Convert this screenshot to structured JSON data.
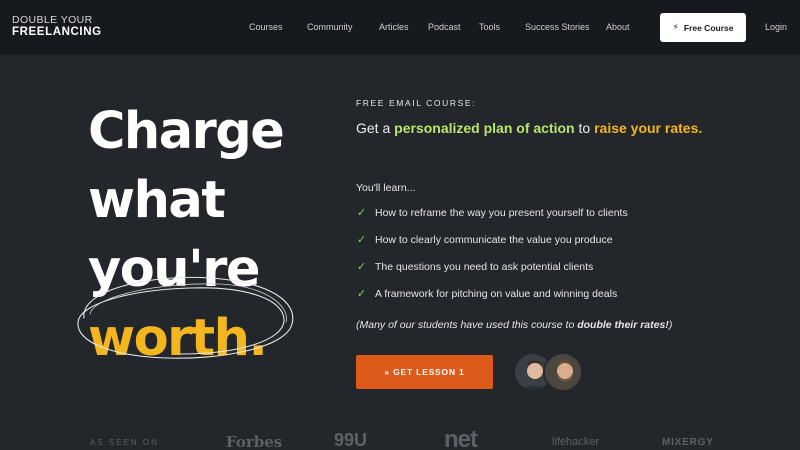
{
  "logo": {
    "line1": "DOUBLE YOUR",
    "line2": "FREELANCING"
  },
  "nav": {
    "items": [
      "Courses",
      "Community",
      "Articles",
      "Podcast",
      "Tools",
      "Success Stories",
      "About"
    ],
    "cta_label": "Free Course",
    "login": "Login"
  },
  "hero": {
    "headline": [
      "Charge",
      "what",
      "you're",
      "worth."
    ],
    "eyebrow": "FREE EMAIL COURSE:",
    "subhead": {
      "part1": "Get a ",
      "highlight1": "personalized plan of action",
      "part2": " to ",
      "highlight2": "raise your rates."
    },
    "learn_label": "You'll learn...",
    "bullets": [
      "How to reframe the way you present yourself to clients",
      "How to clearly communicate the value you produce",
      "The questions you need to ask potential clients",
      "A framework for pitching on value and winning deals"
    ],
    "note": {
      "before": "(Many of our students have used this course to ",
      "bold": "double their rates!",
      "after": ")"
    },
    "cta_label": "» GET LESSON 1"
  },
  "press": {
    "label": "AS SEEN ON:",
    "logos": [
      "Forbes",
      "99U",
      "net",
      "lifehacker",
      "MIXERGY"
    ]
  },
  "colors": {
    "background": "#23262b",
    "nav": "#16191d",
    "accent_yellow": "#f3b61f",
    "accent_green": "#b9e56b",
    "cta_orange": "#de5a1a",
    "check_green": "#7ed957"
  }
}
